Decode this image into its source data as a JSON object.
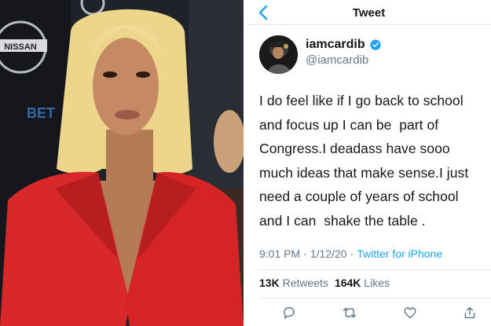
{
  "photo": {
    "sponsor_logo_text": "NISSAN",
    "background_logo_text": "BET"
  },
  "header": {
    "title": "Tweet",
    "back_icon": "chevron-left-icon"
  },
  "author": {
    "display_name": "iamcardib",
    "handle": "@iamcardib",
    "verified_icon": "verified-badge-icon"
  },
  "tweet": {
    "lines": [
      "I do feel like if I go back to school",
      "and focus up I can be  part of",
      "Congress.I deadass have sooo",
      "much ideas that make sense.I just",
      "need a couple of years of school",
      "and I can  shake the table ."
    ]
  },
  "meta": {
    "time": "9:01 PM",
    "separator": "·",
    "date": "1/12/20",
    "source": "Twitter for iPhone"
  },
  "stats": {
    "retweets_count": "13K",
    "retweets_label": "Retweets",
    "likes_count": "164K",
    "likes_label": "Likes"
  },
  "actions": [
    "reply-icon",
    "retweet-icon",
    "like-icon",
    "share-icon"
  ],
  "colors": {
    "accent": "#1da1f2",
    "text": "#14171a",
    "secondary_text": "#657786",
    "border": "#e1e8ed",
    "jacket": "#d8282a"
  }
}
